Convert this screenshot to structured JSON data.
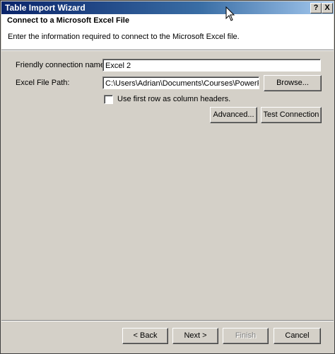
{
  "window": {
    "title": "Table Import Wizard",
    "help_button": "?",
    "close_button": "X"
  },
  "header": {
    "title": "Connect to a Microsoft Excel File",
    "description": "Enter the information required to connect to the Microsoft Excel file."
  },
  "form": {
    "friendly_name_label": "Friendly connection name:",
    "friendly_name_value": "Excel 2",
    "file_path_label": "Excel File Path:",
    "file_path_value": "C:\\Users\\Adrian\\Documents\\Courses\\PowerPivot C",
    "browse_label": "Browse...",
    "first_row_headers_label": "Use first row as column headers.",
    "first_row_headers_checked": false,
    "advanced_label": "Advanced...",
    "test_connection_label": "Test Connection"
  },
  "footer": {
    "back_label": "< Back",
    "next_label": "Next >",
    "finish_label": "Finish",
    "cancel_label": "Cancel"
  }
}
